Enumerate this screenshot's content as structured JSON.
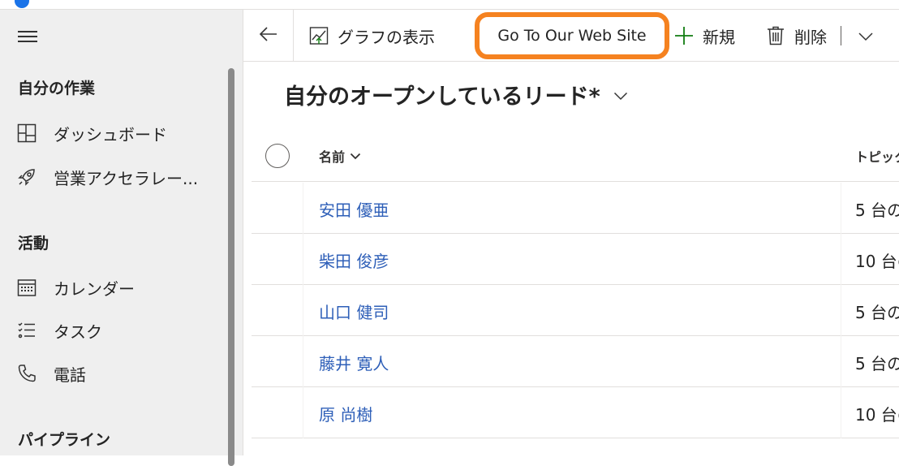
{
  "sidebar": {
    "groups": [
      {
        "title": "自分の作業",
        "items": [
          {
            "label": "ダッシュボード",
            "icon": "dashboard-icon"
          },
          {
            "label": "営業アクセラレー...",
            "icon": "rocket-icon"
          }
        ]
      },
      {
        "title": "活動",
        "items": [
          {
            "label": "カレンダー",
            "icon": "calendar-icon"
          },
          {
            "label": "タスク",
            "icon": "task-list-icon"
          },
          {
            "label": "電話",
            "icon": "phone-icon"
          }
        ]
      },
      {
        "title": "パイプライン",
        "items": []
      }
    ]
  },
  "commandbar": {
    "show_chart": "グラフの表示",
    "goto_website": "Go To Our Web Site",
    "new": "新規",
    "delete": "削除"
  },
  "view": {
    "title": "自分のオープンしているリード*"
  },
  "grid": {
    "columns": {
      "name": "名前",
      "topic": "トピック"
    },
    "rows": [
      {
        "name": "安田 優亜",
        "topic": "5 台の"
      },
      {
        "name": "柴田 俊彦",
        "topic": "10 台の"
      },
      {
        "name": "山口 健司",
        "topic": "5 台の"
      },
      {
        "name": "藤井 寛人",
        "topic": "5 台の"
      },
      {
        "name": "原 尚樹",
        "topic": "10 台の"
      }
    ]
  },
  "colors": {
    "highlight": "#f58220",
    "link": "#2e5fb8",
    "new_plus": "#107c10",
    "sidebar_bg": "#efefef"
  }
}
